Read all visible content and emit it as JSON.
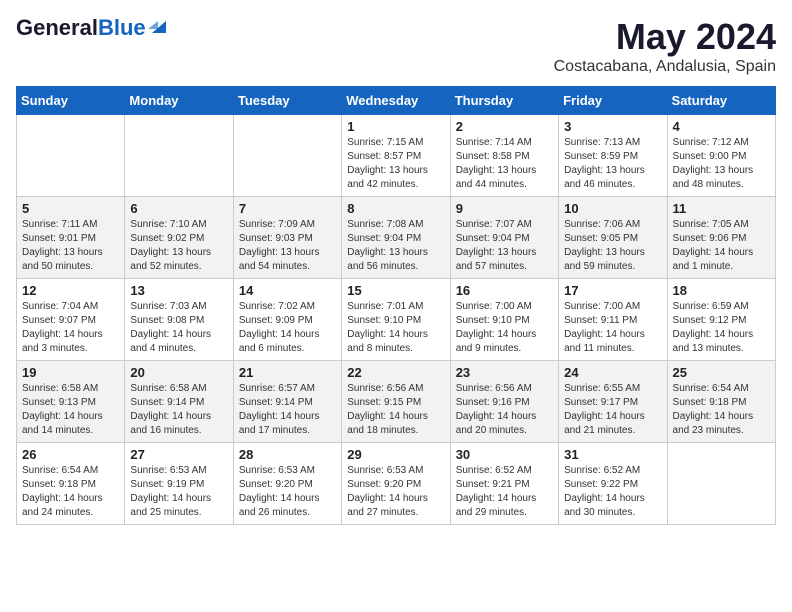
{
  "header": {
    "logo_general": "General",
    "logo_blue": "Blue",
    "month_title": "May 2024",
    "location": "Costacabana, Andalusia, Spain"
  },
  "weekdays": [
    "Sunday",
    "Monday",
    "Tuesday",
    "Wednesday",
    "Thursday",
    "Friday",
    "Saturday"
  ],
  "weeks": [
    [
      {
        "day": "",
        "info": ""
      },
      {
        "day": "",
        "info": ""
      },
      {
        "day": "",
        "info": ""
      },
      {
        "day": "1",
        "info": "Sunrise: 7:15 AM\nSunset: 8:57 PM\nDaylight: 13 hours\nand 42 minutes."
      },
      {
        "day": "2",
        "info": "Sunrise: 7:14 AM\nSunset: 8:58 PM\nDaylight: 13 hours\nand 44 minutes."
      },
      {
        "day": "3",
        "info": "Sunrise: 7:13 AM\nSunset: 8:59 PM\nDaylight: 13 hours\nand 46 minutes."
      },
      {
        "day": "4",
        "info": "Sunrise: 7:12 AM\nSunset: 9:00 PM\nDaylight: 13 hours\nand 48 minutes."
      }
    ],
    [
      {
        "day": "5",
        "info": "Sunrise: 7:11 AM\nSunset: 9:01 PM\nDaylight: 13 hours\nand 50 minutes."
      },
      {
        "day": "6",
        "info": "Sunrise: 7:10 AM\nSunset: 9:02 PM\nDaylight: 13 hours\nand 52 minutes."
      },
      {
        "day": "7",
        "info": "Sunrise: 7:09 AM\nSunset: 9:03 PM\nDaylight: 13 hours\nand 54 minutes."
      },
      {
        "day": "8",
        "info": "Sunrise: 7:08 AM\nSunset: 9:04 PM\nDaylight: 13 hours\nand 56 minutes."
      },
      {
        "day": "9",
        "info": "Sunrise: 7:07 AM\nSunset: 9:04 PM\nDaylight: 13 hours\nand 57 minutes."
      },
      {
        "day": "10",
        "info": "Sunrise: 7:06 AM\nSunset: 9:05 PM\nDaylight: 13 hours\nand 59 minutes."
      },
      {
        "day": "11",
        "info": "Sunrise: 7:05 AM\nSunset: 9:06 PM\nDaylight: 14 hours\nand 1 minute."
      }
    ],
    [
      {
        "day": "12",
        "info": "Sunrise: 7:04 AM\nSunset: 9:07 PM\nDaylight: 14 hours\nand 3 minutes."
      },
      {
        "day": "13",
        "info": "Sunrise: 7:03 AM\nSunset: 9:08 PM\nDaylight: 14 hours\nand 4 minutes."
      },
      {
        "day": "14",
        "info": "Sunrise: 7:02 AM\nSunset: 9:09 PM\nDaylight: 14 hours\nand 6 minutes."
      },
      {
        "day": "15",
        "info": "Sunrise: 7:01 AM\nSunset: 9:10 PM\nDaylight: 14 hours\nand 8 minutes."
      },
      {
        "day": "16",
        "info": "Sunrise: 7:00 AM\nSunset: 9:10 PM\nDaylight: 14 hours\nand 9 minutes."
      },
      {
        "day": "17",
        "info": "Sunrise: 7:00 AM\nSunset: 9:11 PM\nDaylight: 14 hours\nand 11 minutes."
      },
      {
        "day": "18",
        "info": "Sunrise: 6:59 AM\nSunset: 9:12 PM\nDaylight: 14 hours\nand 13 minutes."
      }
    ],
    [
      {
        "day": "19",
        "info": "Sunrise: 6:58 AM\nSunset: 9:13 PM\nDaylight: 14 hours\nand 14 minutes."
      },
      {
        "day": "20",
        "info": "Sunrise: 6:58 AM\nSunset: 9:14 PM\nDaylight: 14 hours\nand 16 minutes."
      },
      {
        "day": "21",
        "info": "Sunrise: 6:57 AM\nSunset: 9:14 PM\nDaylight: 14 hours\nand 17 minutes."
      },
      {
        "day": "22",
        "info": "Sunrise: 6:56 AM\nSunset: 9:15 PM\nDaylight: 14 hours\nand 18 minutes."
      },
      {
        "day": "23",
        "info": "Sunrise: 6:56 AM\nSunset: 9:16 PM\nDaylight: 14 hours\nand 20 minutes."
      },
      {
        "day": "24",
        "info": "Sunrise: 6:55 AM\nSunset: 9:17 PM\nDaylight: 14 hours\nand 21 minutes."
      },
      {
        "day": "25",
        "info": "Sunrise: 6:54 AM\nSunset: 9:18 PM\nDaylight: 14 hours\nand 23 minutes."
      }
    ],
    [
      {
        "day": "26",
        "info": "Sunrise: 6:54 AM\nSunset: 9:18 PM\nDaylight: 14 hours\nand 24 minutes."
      },
      {
        "day": "27",
        "info": "Sunrise: 6:53 AM\nSunset: 9:19 PM\nDaylight: 14 hours\nand 25 minutes."
      },
      {
        "day": "28",
        "info": "Sunrise: 6:53 AM\nSunset: 9:20 PM\nDaylight: 14 hours\nand 26 minutes."
      },
      {
        "day": "29",
        "info": "Sunrise: 6:53 AM\nSunset: 9:20 PM\nDaylight: 14 hours\nand 27 minutes."
      },
      {
        "day": "30",
        "info": "Sunrise: 6:52 AM\nSunset: 9:21 PM\nDaylight: 14 hours\nand 29 minutes."
      },
      {
        "day": "31",
        "info": "Sunrise: 6:52 AM\nSunset: 9:22 PM\nDaylight: 14 hours\nand 30 minutes."
      },
      {
        "day": "",
        "info": ""
      }
    ]
  ]
}
